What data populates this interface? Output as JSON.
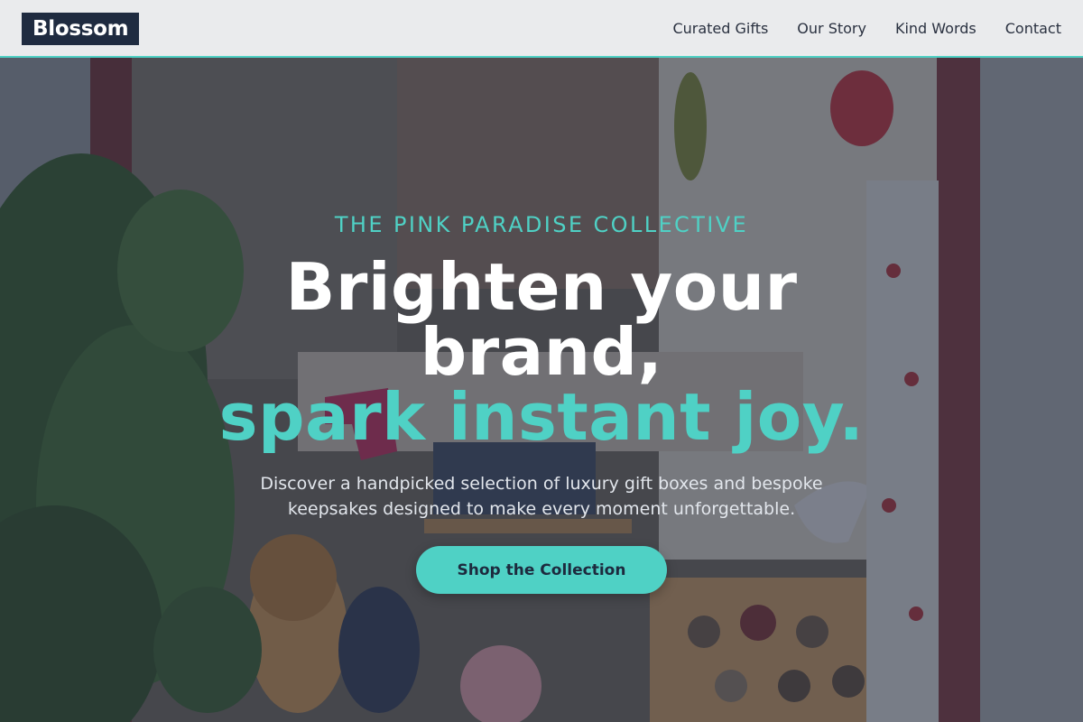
{
  "header": {
    "logo": "Blossom",
    "nav": [
      {
        "label": "Curated Gifts"
      },
      {
        "label": "Our Story"
      },
      {
        "label": "Kind Words"
      },
      {
        "label": "Contact"
      }
    ]
  },
  "hero": {
    "eyebrow": "THE PINK PARADISE COLLECTIVE",
    "headline_line1": "Brighten your",
    "headline_line2": "brand,",
    "headline_accent": "spark instant joy.",
    "subcopy": "Discover a handpicked selection of luxury gift boxes and bespoke keepsakes designed to make every moment unforgettable.",
    "cta_label": "Shop the Collection"
  },
  "colors": {
    "accent": "#4fd1c5",
    "logo_bg": "#1f2b40",
    "header_bg": "#f0f1f3"
  }
}
